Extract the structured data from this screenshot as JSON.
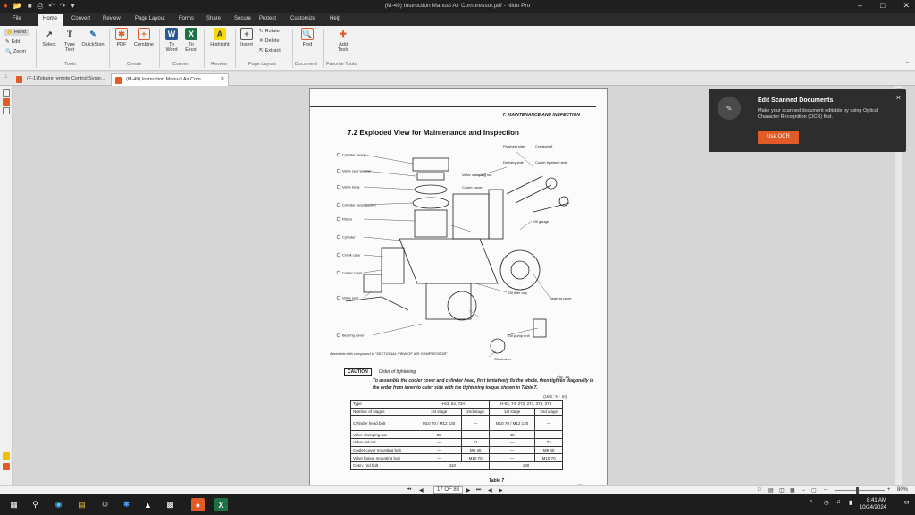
{
  "window": {
    "title": "(M-49) Instruction Manual Air Compressor.pdf - Nitro Pro"
  },
  "menu": {
    "file": "File",
    "items": [
      "Home",
      "Convert",
      "Review",
      "Page Layout",
      "Forms",
      "Share",
      "Secure",
      "Protect",
      "Customize",
      "Help"
    ],
    "active": "Home"
  },
  "ribbon": {
    "hand": "Hand",
    "edit": "Edit",
    "zoom": "Zoom",
    "select": "Select",
    "type_text": "Type Text",
    "quicksign": "QuickSign",
    "pdf": "PDF",
    "combine": "Combine",
    "to_word": "To Word",
    "to_excel": "To Excel",
    "highlight": "Highlight",
    "insert": "Insert",
    "rotate": "Rotate",
    "delete": "Delete",
    "extract": "Extract",
    "find": "Find",
    "add_tools": "Add Tools",
    "groups": {
      "tools": "Tools",
      "create": "Create",
      "convert": "Convert",
      "review": "Review",
      "page_layout": "Page Layout",
      "document": "Document",
      "favorite_tools": "Favorite Tools"
    }
  },
  "tabs": [
    {
      "label": "(F-1)Tokaire remote Control Syste..."
    },
    {
      "label": "(M-49) Instruction Manual Air Com..."
    }
  ],
  "page": {
    "header": "7. MAINTENANCE AND INSPECTION",
    "title": "7.2  Exploded View for Maintenance and Inspection",
    "labels_left": [
      "Cylinder head",
      "Valve seat washer",
      "Valve body",
      "Cylinder head gasket",
      "Piston",
      "Cylinder",
      "Crank case",
      "Cooler cover",
      "Valve seat",
      "Bearing cover"
    ],
    "labels_right": [
      "Flywheel side",
      "Crankshaft",
      "Delivery side",
      "Cooler flywheel side",
      "Valve clamping nut",
      "Cooler cover",
      "Oil gauge",
      "Oil filler cap",
      "Bearing cover",
      "Oil pump unit",
      "Oil strainer"
    ],
    "assembly_note": "Assemble with compound in \"SECTIONAL VIEW OF AIR COMPRESSOR\"",
    "caution_label": "CAUTION",
    "caution_title": "Order of tightening",
    "fig": "Fig. 36",
    "note": "To assemble the cooler cover and cylinder head, first tentatively fix the whole, then tighten diagonally in the order from inner to outer side with the tightening torque shown in Table 7.",
    "unit": "(Unit : N · m)",
    "table": {
      "type_label": "Type",
      "col_a": "H-63, 64, 73A",
      "col_b": "H-63, 74, 273, 274, 373, 374",
      "stages_label": "Number of stages",
      "first": "1st stage",
      "second": "2nd stage",
      "rows": [
        {
          "name": "Cylinder head bolt",
          "a1": "M10  70 / M12  120",
          "a2": "—",
          "b1": "M10  70 / M12  120",
          "b2": "—"
        },
        {
          "name": "Valve clamping nut",
          "a1": "25",
          "a2": "—",
          "b1": "45",
          "b2": "—"
        },
        {
          "name": "Valve set nut",
          "a1": "—",
          "a2": "11",
          "b1": "—",
          "b2": "23"
        },
        {
          "name": "Cooler cover mounting bolt",
          "a1": "—",
          "a2": "M8  40",
          "b1": "—",
          "b2": "M8  40"
        },
        {
          "name": "Valve flange mounting bolt",
          "a1": "—",
          "a2": "M10  70",
          "b1": "—",
          "b2": "M10  70"
        },
        {
          "name": "Conn. rod bolt",
          "a1": "110",
          "a2": "",
          "b1": "180",
          "b2": ""
        }
      ],
      "caption": "Table 7"
    },
    "pgnum": "87"
  },
  "popup": {
    "title": "Edit Scanned Documents",
    "desc": "Make your scanned document editable by using Optical Character Recognition (OCR) first.",
    "button": "Use OCR"
  },
  "status": {
    "page": "17 OF 88",
    "zoom": "80%"
  },
  "clock": {
    "time": "8:41 AM",
    "date": "10/24/2024"
  },
  "colors": {
    "accent": "#e25b26",
    "dark": "#2d2d2d"
  }
}
